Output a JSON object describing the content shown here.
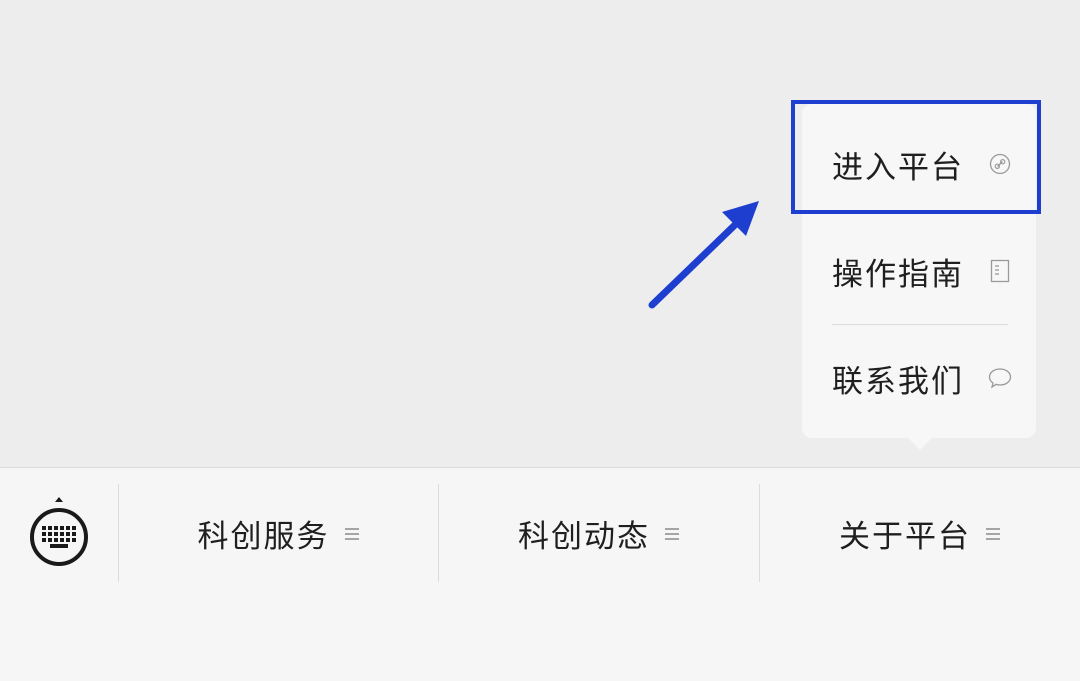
{
  "popup_menu": {
    "items": [
      {
        "label": "进入平台",
        "icon": "link-icon"
      },
      {
        "label": "操作指南",
        "icon": "document-icon"
      },
      {
        "label": "联系我们",
        "icon": "chat-bubble-icon"
      }
    ]
  },
  "annotation": {
    "highlight_color": "#1e3ed0",
    "arrow_color": "#1e3ed0"
  },
  "bottom_menu": {
    "keyboard_icon": "keyboard-icon",
    "items": [
      {
        "label": "科创服务",
        "icon": "menu-lines-icon"
      },
      {
        "label": "科创动态",
        "icon": "menu-lines-icon"
      },
      {
        "label": "关于平台",
        "icon": "menu-lines-icon"
      }
    ]
  }
}
